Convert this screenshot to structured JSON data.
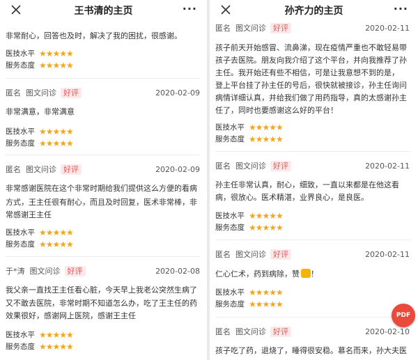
{
  "left": {
    "title": "王书清的主页",
    "more": "···",
    "reviews": [
      {
        "name": "",
        "method": "",
        "badge": "",
        "date": "",
        "lines": [
          "非常耐心，回答也及时，解决了我的困扰，很感谢。"
        ],
        "skill_label": "医技水平",
        "service_label": "服务态度",
        "skill_stars": 5,
        "service_stars": 5
      },
      {
        "name": "匿名",
        "method": "图文问诊",
        "badge": "好评",
        "date": "2020-02-09",
        "lines": [
          "非常满意，非常满意"
        ],
        "skill_label": "医技水平",
        "service_label": "服务态度",
        "skill_stars": 5,
        "service_stars": 5
      },
      {
        "name": "匿名",
        "method": "图文问诊",
        "badge": "好评",
        "date": "2020-02-09",
        "lines": [
          "非常感谢医院在这个非常时期给我们提供这么方便的看病",
          "方式，王主任很有耐心，而且及时回复，医术非常棒，非",
          "常感谢王主任"
        ],
        "skill_label": "医技水平",
        "service_label": "服务态度",
        "skill_stars": 5,
        "service_stars": 5
      },
      {
        "name": "于*涛",
        "method": "图文问诊",
        "badge": "好评",
        "date": "2020-02-08",
        "lines": [
          "我父亲一直找王主任看心脏，今天早上我老公突然生病了",
          "又不敢去医院，非常时期不知道怎么办，吃了王主任的药",
          "效果很好，感谢网上医院，感谢王主任"
        ],
        "skill_label": "医技水平",
        "service_label": "服务态度",
        "skill_stars": 5,
        "service_stars": 5
      }
    ]
  },
  "right": {
    "title": "孙齐力的主页",
    "more": "···",
    "reviews": [
      {
        "name": "匿名",
        "method": "图文问诊",
        "badge": "好评",
        "date": "2020-02-11",
        "lines": [
          "孩子前天开始感冒、流鼻涕，现在疫情严重也不敢轻易带",
          "孩子去医院。朋友向我介绍了这个平台，并向我推荐了孙",
          "主任。我开始还有些不相信，可是让我意想不到的是，",
          "登上平台挂了孙主任的号后，很快就被接诊，孙主任询问",
          "病情详细认真，并给我们做了用药指导，真的太感谢孙主",
          "任了，同时也要感谢这么好的平台！"
        ],
        "skill_label": "医技水平",
        "service_label": "服务态度",
        "skill_stars": 5,
        "service_stars": 5
      },
      {
        "name": "匿名",
        "method": "图文问诊",
        "badge": "好评",
        "date": "2020-02-11",
        "lines": [
          "孙主任非常认真，耐心，细致，一直以来都是在他这看",
          "病，很放心。医术精湛，业界良心，是良医。"
        ],
        "skill_label": "医技水平",
        "service_label": "服务态度",
        "skill_stars": 5,
        "service_stars": 5
      },
      {
        "name": "匿名",
        "method": "图文问诊",
        "badge": "好评",
        "date": "2020-02-11",
        "lines": [
          "仁心仁术，药到病除，赞"
        ],
        "trail": "！",
        "skill_label": "医技水平",
        "service_label": "服务态度",
        "skill_stars": 5,
        "service_stars": 5
      },
      {
        "name": "匿名",
        "method": "图文问诊",
        "badge": "好评",
        "date": "2020-02-10",
        "lines": [
          "孩子吃了药，退烧了，睡得很安稳。慕名而来，孙大夫医"
        ]
      }
    ]
  },
  "pdf_button": "PDF",
  "star_glyphs": "★★★★★",
  "colors": {
    "star": "#f3a51c",
    "badge_text": "#e05a5a",
    "badge_bg": "#fde9e9",
    "pdf": "#ea4a3c"
  }
}
